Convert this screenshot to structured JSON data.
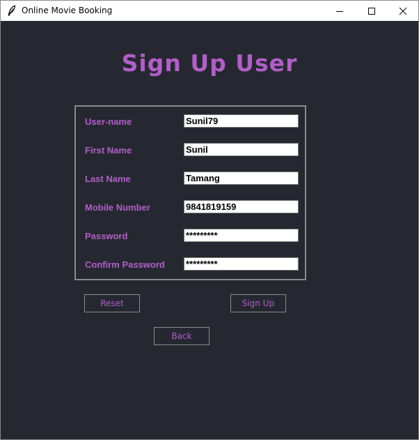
{
  "window": {
    "title": "Online Movie Booking",
    "icon": "feather-icon",
    "controls": [
      "minimize-icon",
      "maximize-icon",
      "close-icon"
    ]
  },
  "heading": "Sign Up User",
  "form": {
    "fields": [
      {
        "label": "User-name",
        "value": "Sunil79"
      },
      {
        "label": "First Name",
        "value": "Sunil"
      },
      {
        "label": "Last Name",
        "value": "Tamang"
      },
      {
        "label": "Mobile Number",
        "value": "9841819159"
      },
      {
        "label": "Password",
        "value": "*********"
      },
      {
        "label": "Confirm Password",
        "value": "*********"
      }
    ]
  },
  "buttons": {
    "reset": "Reset",
    "signup": "Sign Up",
    "back": "Back"
  },
  "colors": {
    "background": "#252830",
    "accent": "#b25ec9",
    "border": "#8c8c8c"
  }
}
